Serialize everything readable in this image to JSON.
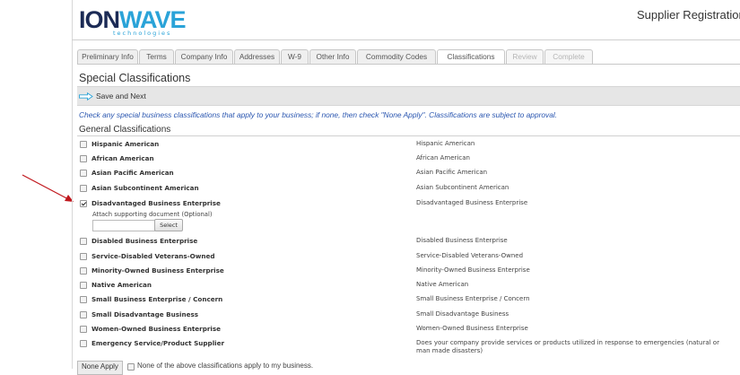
{
  "header": {
    "logo_main_ion": "ION",
    "logo_main_wave": "WAVE",
    "logo_sub": "technologies",
    "title": "Supplier Registration"
  },
  "tabs": [
    {
      "label": "Preliminary Info",
      "state": "normal"
    },
    {
      "label": "Terms",
      "state": "normal"
    },
    {
      "label": "Company Info",
      "state": "normal"
    },
    {
      "label": "Addresses",
      "state": "normal"
    },
    {
      "label": "W-9",
      "state": "normal"
    },
    {
      "label": "Other Info",
      "state": "normal"
    },
    {
      "label": "Commodity Codes",
      "state": "normal"
    },
    {
      "label": "Classifications",
      "state": "active"
    },
    {
      "label": "Review",
      "state": "disabled"
    },
    {
      "label": "Complete",
      "state": "disabled"
    }
  ],
  "page": {
    "title": "Special Classifications",
    "save_label": "Save and Next",
    "instructions": "Check any special business classifications that apply to your business; if none, then check \"None Apply\". Classifications are subject to approval.",
    "subsection": "General Classifications"
  },
  "classifications": [
    {
      "name": "Hispanic American",
      "desc": "Hispanic American",
      "checked": false
    },
    {
      "name": "African American",
      "desc": "African American",
      "checked": false
    },
    {
      "name": "Asian Pacific American",
      "desc": "Asian Pacific American",
      "checked": false
    },
    {
      "name": "Asian Subcontinent American",
      "desc": "Asian Subcontinent American",
      "checked": false
    },
    {
      "name": "Disadvantaged Business Enterprise",
      "desc": "Disadvantaged Business Enterprise",
      "checked": true
    },
    {
      "name": "Disabled Business Enterprise",
      "desc": "Disabled Business Enterprise",
      "checked": false
    },
    {
      "name": "Service-Disabled Veterans-Owned",
      "desc": "Service-Disabled Veterans-Owned",
      "checked": false
    },
    {
      "name": "Minority-Owned Business Enterprise",
      "desc": "Minority-Owned Business Enterprise",
      "checked": false
    },
    {
      "name": "Native American",
      "desc": "Native American",
      "checked": false
    },
    {
      "name": "Small Business Enterprise / Concern",
      "desc": "Small Business Enterprise / Concern",
      "checked": false
    },
    {
      "name": "Small Disadvantage Business",
      "desc": "Small Disadvantage Business",
      "checked": false
    },
    {
      "name": "Women-Owned Business Enterprise",
      "desc": "Women-Owned Business Enterprise",
      "checked": false
    },
    {
      "name": "Emergency Service/Product Supplier",
      "desc": "Does your company provide services or products utilized in response to emergencies (natural or",
      "desc2": "man made disasters)",
      "checked": false
    }
  ],
  "attachment": {
    "label": "Attach supporting document (Optional)",
    "button_label": "Select"
  },
  "none_apply": {
    "button_label": "None Apply",
    "checkbox_label": "None of the above classifications apply to my business."
  },
  "colors": {
    "logo_dark": "#1b2a55",
    "logo_accent": "#2aa3d8",
    "instruction_text": "#2a56b0",
    "annotation_arrow": "#c0161c"
  }
}
